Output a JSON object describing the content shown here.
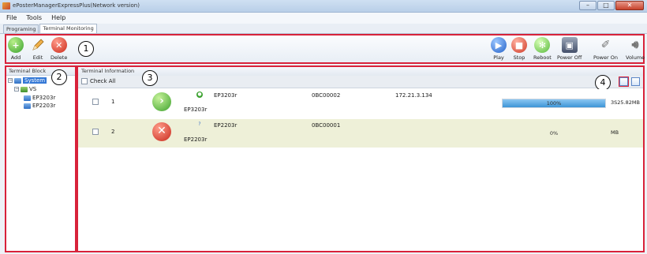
{
  "window": {
    "title": "ePosterManagerExpressPlus(Network version)",
    "buttons": [
      "–",
      "□",
      "✕"
    ]
  },
  "menu": [
    "File",
    "Tools",
    "Help"
  ],
  "tabs": [
    {
      "label": "Programing",
      "active": false
    },
    {
      "label": "Terminal Monitoring",
      "active": true
    }
  ],
  "toolbar": {
    "left": [
      {
        "label": "Add",
        "icon": "add-icon"
      },
      {
        "label": "Edit",
        "icon": "edit-icon"
      },
      {
        "label": "Delete",
        "icon": "delete-icon"
      }
    ],
    "right": [
      {
        "label": "Play",
        "icon": "play-icon"
      },
      {
        "label": "Stop",
        "icon": "stop-icon"
      },
      {
        "label": "Reboot",
        "icon": "reboot-icon"
      },
      {
        "label": "Power Off",
        "icon": "power-off-icon"
      },
      {
        "label": "Power On",
        "icon": "power-on-icon"
      },
      {
        "label": "Volume",
        "icon": "volume-icon"
      }
    ]
  },
  "callouts": [
    "1",
    "2",
    "3",
    "4"
  ],
  "terminal_block": {
    "header": "Terminal Block",
    "tree": {
      "root": "System",
      "group": "VS",
      "items": [
        "EP3203r",
        "EP2203r"
      ]
    }
  },
  "terminal_info": {
    "header": "Terminal Information",
    "check_all": "Check All",
    "rows": [
      {
        "num": "1",
        "status": "playing",
        "model": "EP3203r",
        "model_sub": "EP3203r",
        "code": "0BC00002",
        "ip": "172.21.3.134",
        "progress_pct": 100,
        "progress_label": "100%",
        "size": "3S25.82MB"
      },
      {
        "num": "2",
        "status": "error",
        "model": "EP2203r",
        "model_sub": "EP2203r",
        "code": "0BC00001",
        "ip": "",
        "progress_pct": 0,
        "progress_label": "0%",
        "size": "MB"
      }
    ]
  },
  "colors": {
    "highlight_border": "#d8223a",
    "selected_row": "#eef0d8"
  }
}
